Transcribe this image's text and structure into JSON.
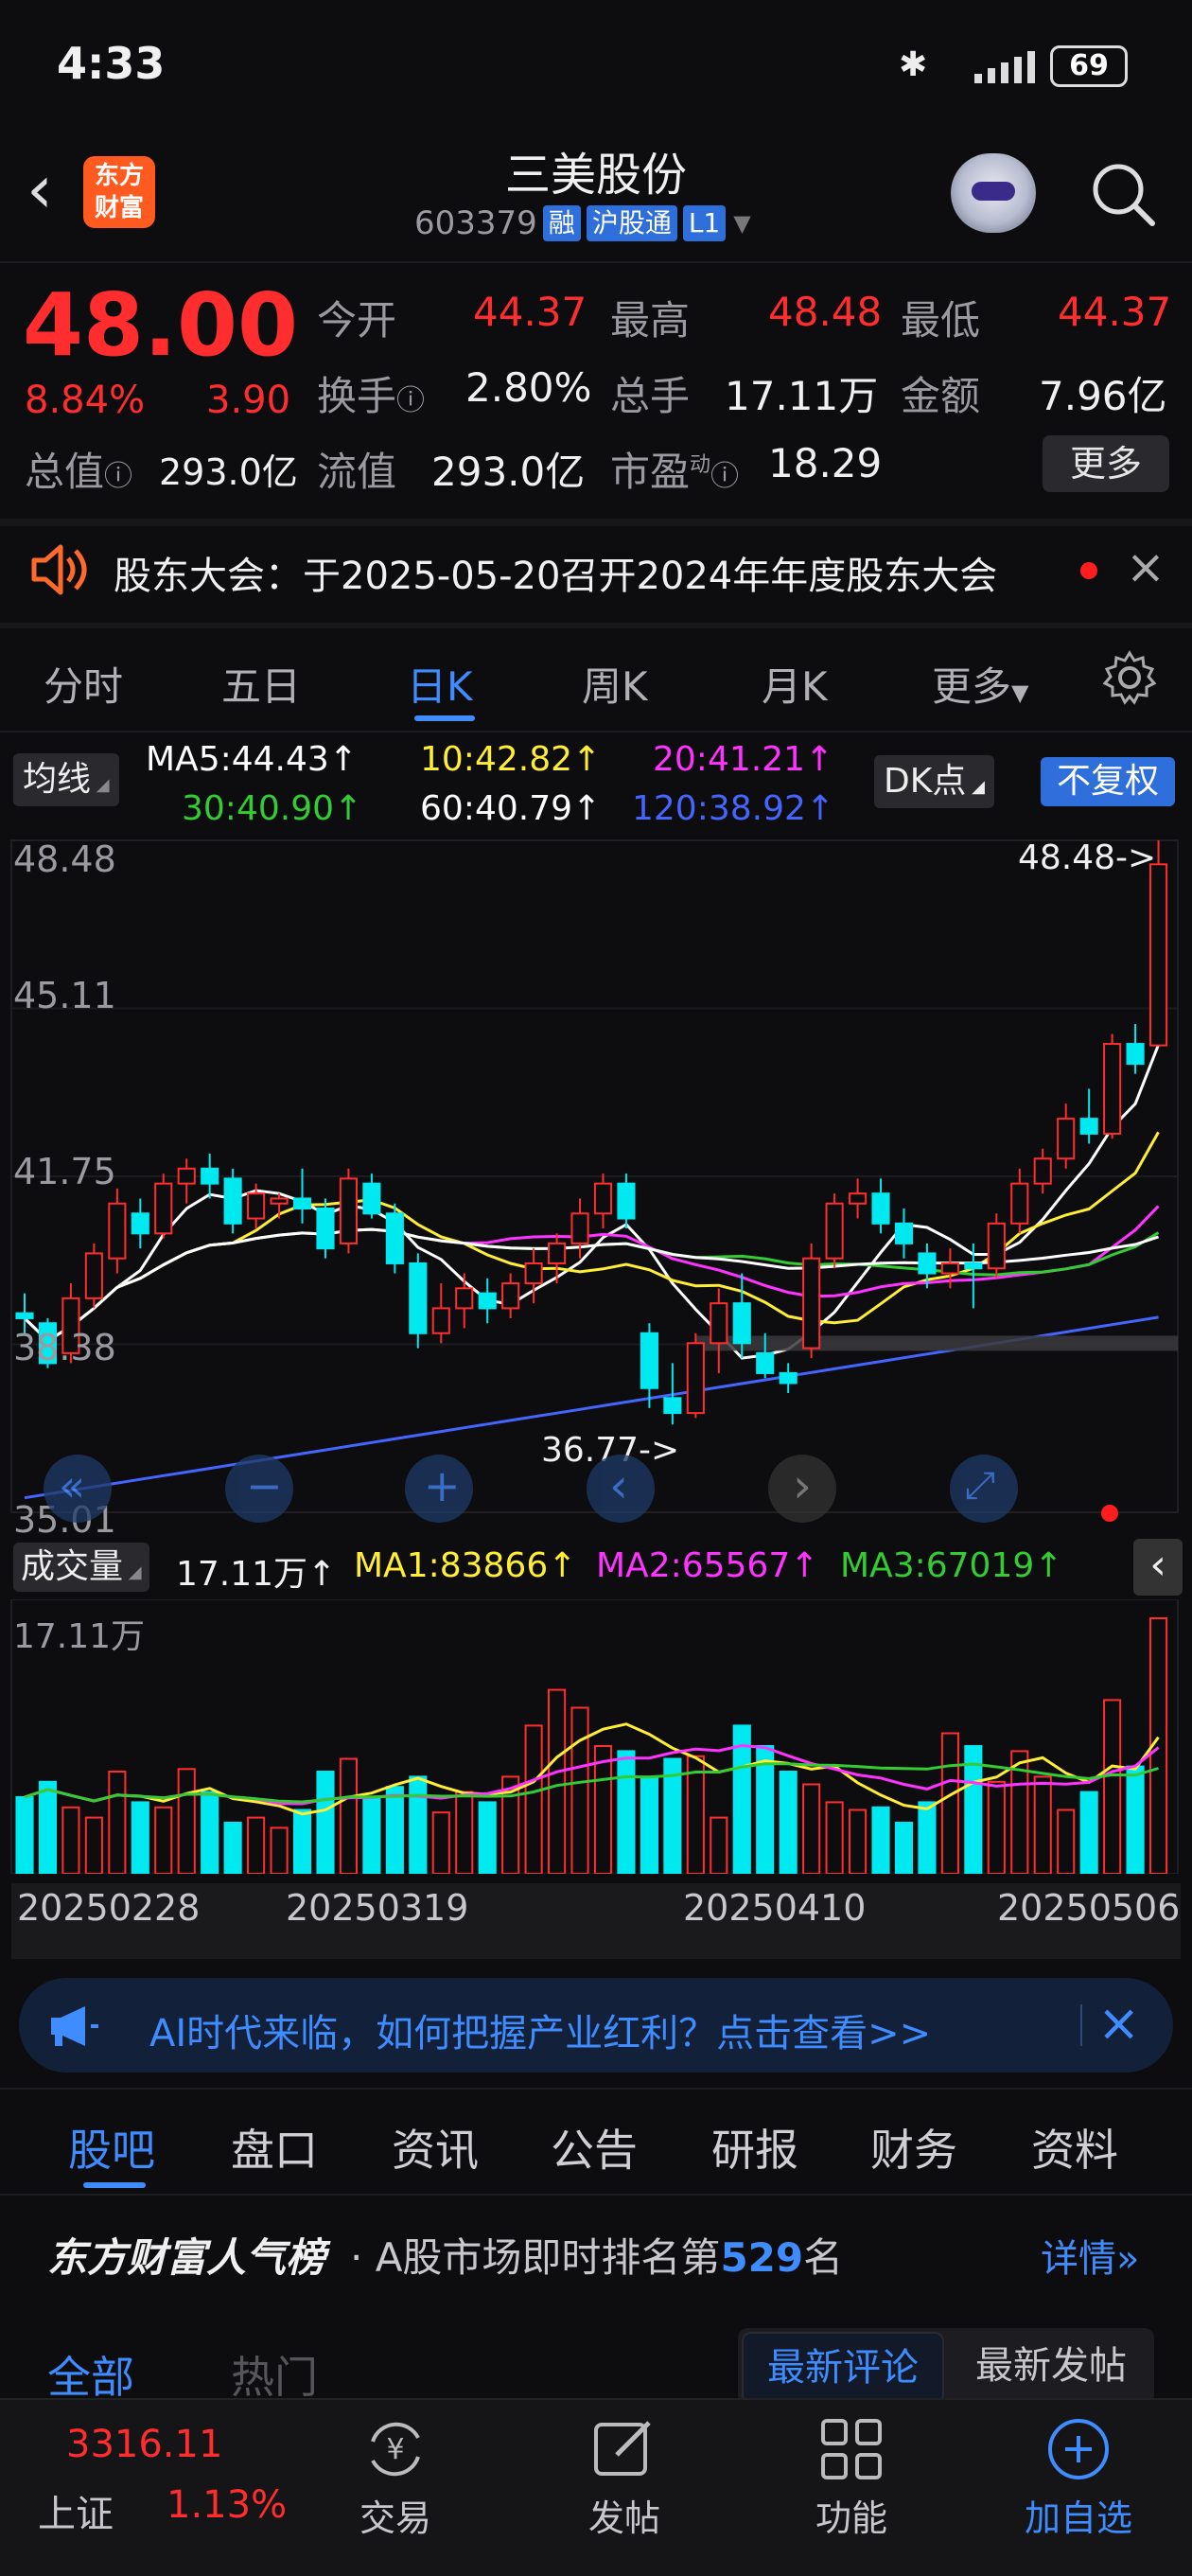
{
  "status_bar": {
    "time": "4:33",
    "battery": "69"
  },
  "header": {
    "logo_line1": "东方",
    "logo_line2": "财富",
    "title": "三美股份",
    "code": "603379",
    "badges": [
      "融",
      "沪股通",
      "L1"
    ]
  },
  "quote": {
    "price": "48.00",
    "change_pct": "8.84%",
    "change": "3.90",
    "fields": [
      {
        "label": "今开",
        "value": "44.37",
        "color": "red"
      },
      {
        "label": "最高",
        "value": "48.48",
        "color": "red"
      },
      {
        "label": "最低",
        "value": "44.37",
        "color": "red"
      },
      {
        "label": "换手",
        "value": "2.80%",
        "color": "white"
      },
      {
        "label": "总手",
        "value": "17.11万",
        "color": "white"
      },
      {
        "label": "金额",
        "value": "7.96亿",
        "color": "white"
      },
      {
        "label": "总值",
        "value": "293.0亿",
        "color": "white"
      },
      {
        "label": "流值",
        "value": "293.0亿",
        "color": "white"
      },
      {
        "label": "市盈",
        "value": "18.29",
        "color": "white"
      }
    ],
    "pe_sup": "动",
    "more_label": "更多"
  },
  "notice": {
    "text": "股东大会：于2025-05-20召开2024年年度股东大会"
  },
  "chart_tabs": {
    "items": [
      "分时",
      "五日",
      "日K",
      "周K",
      "月K",
      "更多"
    ],
    "active": 2
  },
  "ma_legend": {
    "type_label": "均线",
    "ma5": "MA5:44.43↑",
    "ma10": "10:42.82↑",
    "ma20": "20:41.21↑",
    "ma30": "30:40.90↑",
    "ma60": "60:40.79↑",
    "ma120": "120:38.92↑",
    "dk_label": "DK点",
    "adjust_label": "不复权",
    "colors": {
      "ma5": "#ffffff",
      "ma10": "#ffee33",
      "ma20": "#ff33ff",
      "ma30": "#33cc33",
      "ma60": "#ffffff",
      "ma120": "#4466ff"
    }
  },
  "price_axis": [
    "48.48",
    "45.11",
    "41.75",
    "38.38",
    "35.01"
  ],
  "annotations": {
    "high": "48.48->",
    "low": "36.77->"
  },
  "volume_legend": {
    "label": "成交量",
    "vol": "17.11万↑",
    "ma1": "MA1:83866↑",
    "ma2": "MA2:65567↑",
    "ma3": "MA3:67019↑",
    "axis_top": "17.11万"
  },
  "date_axis": [
    "20250228",
    "20250319",
    "20250410",
    "20250506"
  ],
  "ad_banner": {
    "text": "AI时代来临，如何把握产业红利？点击查看>>"
  },
  "section_tabs": {
    "items": [
      "股吧",
      "盘口",
      "资讯",
      "公告",
      "研报",
      "财务",
      "资料"
    ],
    "active": 0
  },
  "popularity": {
    "brand": "东方财富人气榜",
    "text_prefix": "· A股市场即时排名第",
    "rank": "529",
    "text_suffix": "名",
    "detail": "详情"
  },
  "filter": {
    "all": "全部",
    "hot": "热门",
    "latest_comment": "最新评论",
    "latest_post": "最新发帖"
  },
  "bottom_bar": {
    "index_value": "3316.11",
    "index_name": "上证",
    "index_pct": "1.13%",
    "items": [
      "交易",
      "发帖",
      "功能",
      "加自选"
    ]
  },
  "chart_data": {
    "type": "candlestick",
    "ylim": [
      35.01,
      48.48
    ],
    "candles": [
      [
        39.0,
        39.4,
        38.6,
        38.9
      ],
      [
        38.8,
        38.9,
        37.9,
        38.0
      ],
      [
        38.2,
        39.6,
        38.0,
        39.3
      ],
      [
        39.3,
        40.4,
        39.1,
        40.2
      ],
      [
        40.1,
        41.5,
        39.8,
        41.2
      ],
      [
        41.0,
        41.3,
        40.3,
        40.6
      ],
      [
        40.6,
        41.8,
        40.5,
        41.6
      ],
      [
        41.6,
        42.1,
        41.2,
        41.9
      ],
      [
        41.9,
        42.2,
        41.3,
        41.6
      ],
      [
        41.7,
        41.9,
        40.6,
        40.8
      ],
      [
        40.9,
        41.6,
        40.7,
        41.4
      ],
      [
        41.2,
        41.4,
        40.9,
        41.3
      ],
      [
        41.3,
        41.9,
        40.8,
        41.1
      ],
      [
        41.1,
        41.3,
        40.1,
        40.3
      ],
      [
        40.4,
        41.9,
        40.2,
        41.7
      ],
      [
        41.6,
        41.8,
        40.9,
        41.0
      ],
      [
        41.0,
        41.2,
        39.8,
        40.0
      ],
      [
        40.0,
        40.2,
        38.3,
        38.6
      ],
      [
        38.6,
        39.6,
        38.4,
        39.1
      ],
      [
        39.1,
        39.8,
        38.7,
        39.5
      ],
      [
        39.4,
        39.7,
        38.8,
        39.1
      ],
      [
        39.1,
        39.8,
        38.9,
        39.6
      ],
      [
        39.6,
        40.3,
        39.2,
        40.0
      ],
      [
        40.0,
        40.6,
        39.6,
        40.4
      ],
      [
        40.4,
        41.3,
        40.1,
        41.0
      ],
      [
        41.0,
        41.8,
        40.7,
        41.6
      ],
      [
        41.6,
        41.8,
        40.7,
        40.9
      ],
      [
        38.6,
        38.8,
        37.1,
        37.5
      ],
      [
        37.3,
        38.0,
        36.77,
        37.0
      ],
      [
        37.0,
        38.6,
        36.9,
        38.4
      ],
      [
        38.4,
        39.5,
        37.8,
        39.2
      ],
      [
        39.2,
        39.8,
        38.1,
        38.4
      ],
      [
        38.2,
        38.6,
        37.7,
        37.8
      ],
      [
        37.8,
        38.0,
        37.4,
        37.6
      ],
      [
        38.3,
        40.4,
        38.1,
        40.1
      ],
      [
        40.1,
        41.4,
        39.9,
        41.2
      ],
      [
        41.2,
        41.7,
        40.9,
        41.4
      ],
      [
        41.4,
        41.7,
        40.6,
        40.8
      ],
      [
        40.8,
        41.1,
        40.1,
        40.4
      ],
      [
        40.2,
        40.4,
        39.5,
        39.8
      ],
      [
        39.8,
        40.3,
        39.5,
        40.0
      ],
      [
        40.0,
        40.4,
        39.1,
        39.9
      ],
      [
        39.9,
        41.0,
        39.7,
        40.8
      ],
      [
        40.8,
        41.9,
        40.6,
        41.6
      ],
      [
        41.6,
        42.3,
        41.4,
        42.1
      ],
      [
        42.1,
        43.2,
        41.9,
        42.9
      ],
      [
        42.9,
        43.5,
        42.4,
        42.6
      ],
      [
        42.6,
        44.6,
        42.5,
        44.4
      ],
      [
        44.4,
        44.8,
        43.8,
        44.0
      ],
      [
        44.37,
        48.48,
        44.37,
        48.0
      ]
    ],
    "volume": [
      30,
      36,
      26,
      22,
      40,
      28,
      26,
      41,
      32,
      20,
      22,
      18,
      25,
      40,
      45,
      30,
      34,
      38,
      24,
      32,
      28,
      38,
      58,
      72,
      65,
      50,
      48,
      38,
      45,
      46,
      22,
      58,
      50,
      40,
      35,
      28,
      25,
      26,
      20,
      28,
      55,
      50,
      36,
      48,
      38,
      25,
      32,
      68,
      42,
      100
    ]
  }
}
